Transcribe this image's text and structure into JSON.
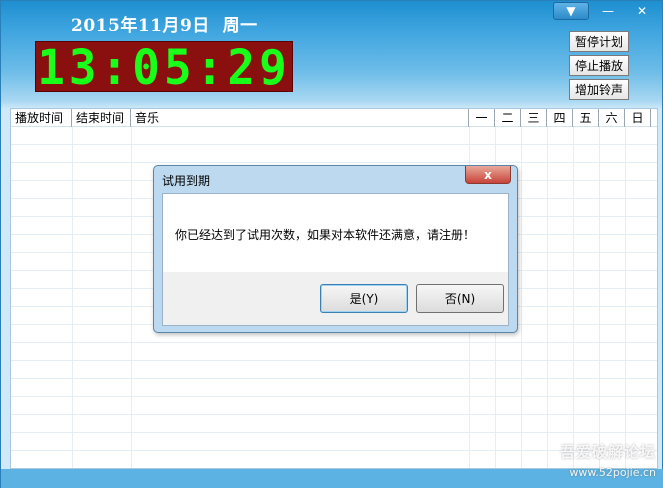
{
  "header": {
    "date": "2015年11月9日",
    "weekday": "周一",
    "clock": "13:05:29"
  },
  "titlebar": {
    "menu_icon": "▼",
    "min_icon": "—",
    "close_icon": "✕"
  },
  "side_buttons": {
    "pause_plan": "暂停计划",
    "stop_play": "停止播放",
    "add_bell": "增加铃声"
  },
  "table": {
    "columns": [
      "播放时间",
      "结束时间",
      "音乐"
    ],
    "weekdays": [
      "一",
      "二",
      "三",
      "四",
      "五",
      "六",
      "日"
    ]
  },
  "dialog": {
    "title": "试用到期",
    "close_icon": "x",
    "message": "你已经达到了试用次数，如果对本软件还满意，请注册！",
    "yes_label": "是(Y)",
    "no_label": "否(N)"
  },
  "watermark": {
    "text": "吾爱破解论坛",
    "url": "www.52pojie.cn"
  }
}
